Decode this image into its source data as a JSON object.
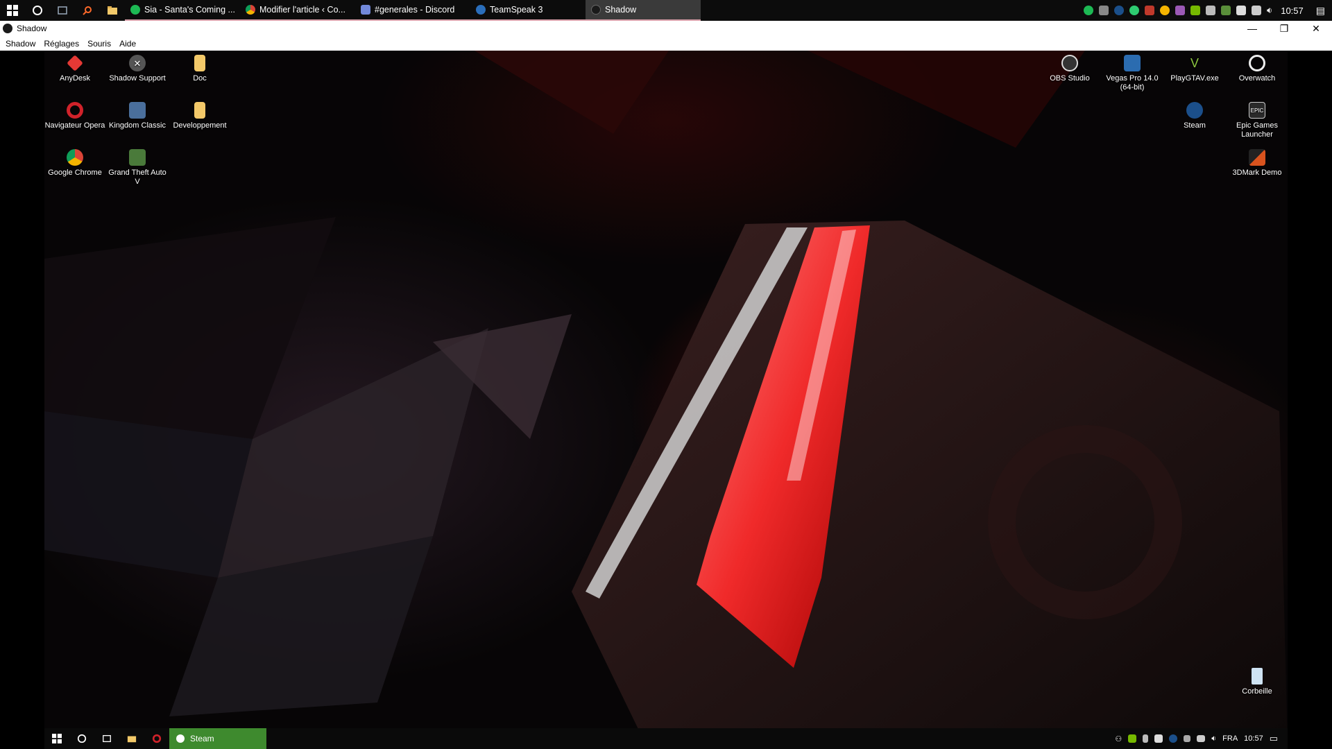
{
  "host_taskbar": {
    "apps": [
      {
        "label": "Sia - Santa's Coming ...",
        "icon": "spotify-icon",
        "color": "#1db954"
      },
      {
        "label": "Modifier l'article ‹ Co...",
        "icon": "chrome-icon",
        "color": "#f4b400"
      },
      {
        "label": "#generales - Discord",
        "icon": "discord-icon",
        "color": "#7289da"
      },
      {
        "label": "TeamSpeak 3",
        "icon": "teamspeak-icon",
        "color": "#2a6ebb"
      },
      {
        "label": "Shadow",
        "icon": "shadow-icon",
        "color": "#444444"
      }
    ],
    "clock": "10:57"
  },
  "window": {
    "title": "Shadow",
    "menu": [
      "Shadow",
      "Réglages",
      "Souris",
      "Aide"
    ],
    "controls": {
      "minimize": "—",
      "restore": "❐",
      "close": "✕"
    }
  },
  "desktop": {
    "icons_left": [
      {
        "label": "AnyDesk",
        "icon": "anydesk-icon",
        "color": "#e53935"
      },
      {
        "label": "Shadow Support",
        "icon": "shadow-support-icon",
        "color": "#555555"
      },
      {
        "label": "Doc",
        "icon": "folder-icon",
        "color": "#f3c969"
      },
      {
        "label": "Navigateur Opera",
        "icon": "opera-icon",
        "color": "#d0222a"
      },
      {
        "label": "Kingdom Classic",
        "icon": "kingdom-icon",
        "color": "#4a6f9c"
      },
      {
        "label": "Developpement",
        "icon": "folder-icon",
        "color": "#f3c969"
      },
      {
        "label": "Google Chrome",
        "icon": "chrome-icon",
        "color": "#f4b400"
      },
      {
        "label": "Grand Theft Auto V",
        "icon": "gta-icon",
        "color": "#4a7a3a"
      }
    ],
    "icons_right": [
      {
        "label": "OBS Studio",
        "icon": "obs-icon",
        "color": "#333333"
      },
      {
        "label": "Vegas Pro 14.0 (64-bit)",
        "icon": "vegas-icon",
        "color": "#2b6cb0"
      },
      {
        "label": "PlayGTAV.exe",
        "icon": "gtav-icon",
        "color": "#5c8a2a"
      },
      {
        "label": "Overwatch",
        "icon": "overwatch-icon",
        "color": "#eeeeee"
      },
      {
        "label": "Steam",
        "icon": "steam-icon",
        "color": "#1b4f8a"
      },
      {
        "label": "Epic Games Launcher",
        "icon": "epic-icon",
        "color": "#2a2a2a"
      },
      {
        "label": "3DMark Demo",
        "icon": "3dmark-icon",
        "color": "#b54a1a"
      }
    ],
    "recycle_bin": {
      "label": "Corbeille",
      "icon": "recycle-bin-icon"
    }
  },
  "remote_taskbar": {
    "active_app": "Steam",
    "language": "FRA",
    "clock": "10:57"
  }
}
